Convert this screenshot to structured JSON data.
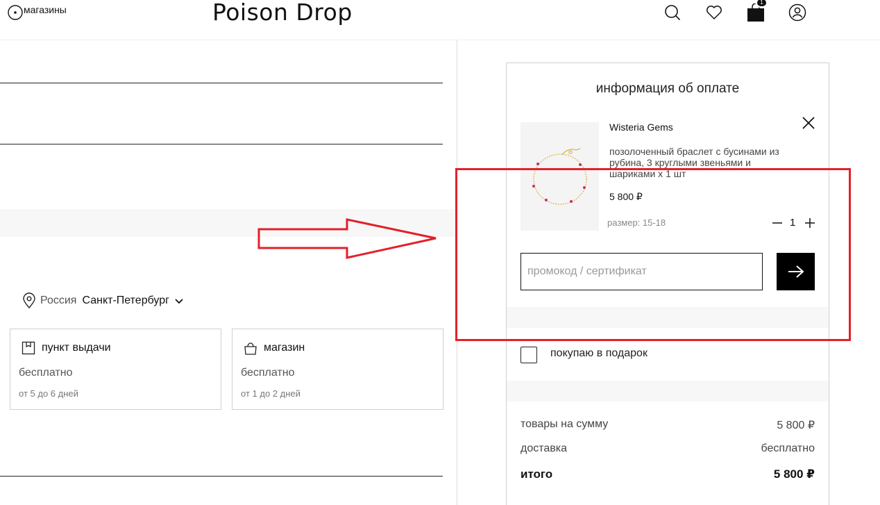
{
  "header": {
    "stores_label": "магазины",
    "logo": "Poison Drop",
    "cart_count": "1",
    "icons": [
      "location-pin-icon",
      "search-icon",
      "heart-icon",
      "bag-icon",
      "user-icon"
    ]
  },
  "left": {
    "location": {
      "country": "Россия",
      "city": "Санкт-Петербург"
    },
    "delivery_options": [
      {
        "title": "пункт выдачи",
        "price": "бесплатно",
        "days": "от 5 до 6 дней",
        "icon": "pickup-box-icon"
      },
      {
        "title": "магазин",
        "price": "бесплатно",
        "days": "от 1 до 2 дней",
        "icon": "shopping-bag-icon"
      }
    ]
  },
  "summary": {
    "title": "информация об оплате",
    "product": {
      "name": "Wisteria Gems",
      "description": "позолоченный браслет с бусинами из рубина, 3 круглыми звеньями и шариками х 1 шт",
      "price": "5 800 ₽",
      "size": "размер: 15-18",
      "quantity": "1"
    },
    "promo_placeholder": "промокод / сертификат",
    "gift_label": "покупаю в подарок",
    "totals": {
      "goods_label": "товары на сумму",
      "goods_value": "5 800 ₽",
      "delivery_label": "доставка",
      "delivery_value": "бесплатно",
      "total_label": "итого",
      "total_value": "5 800 ₽"
    }
  },
  "colors": {
    "annotation_red": "#e3202a",
    "button_black": "#000000",
    "band_grey": "#f7f7f7"
  }
}
